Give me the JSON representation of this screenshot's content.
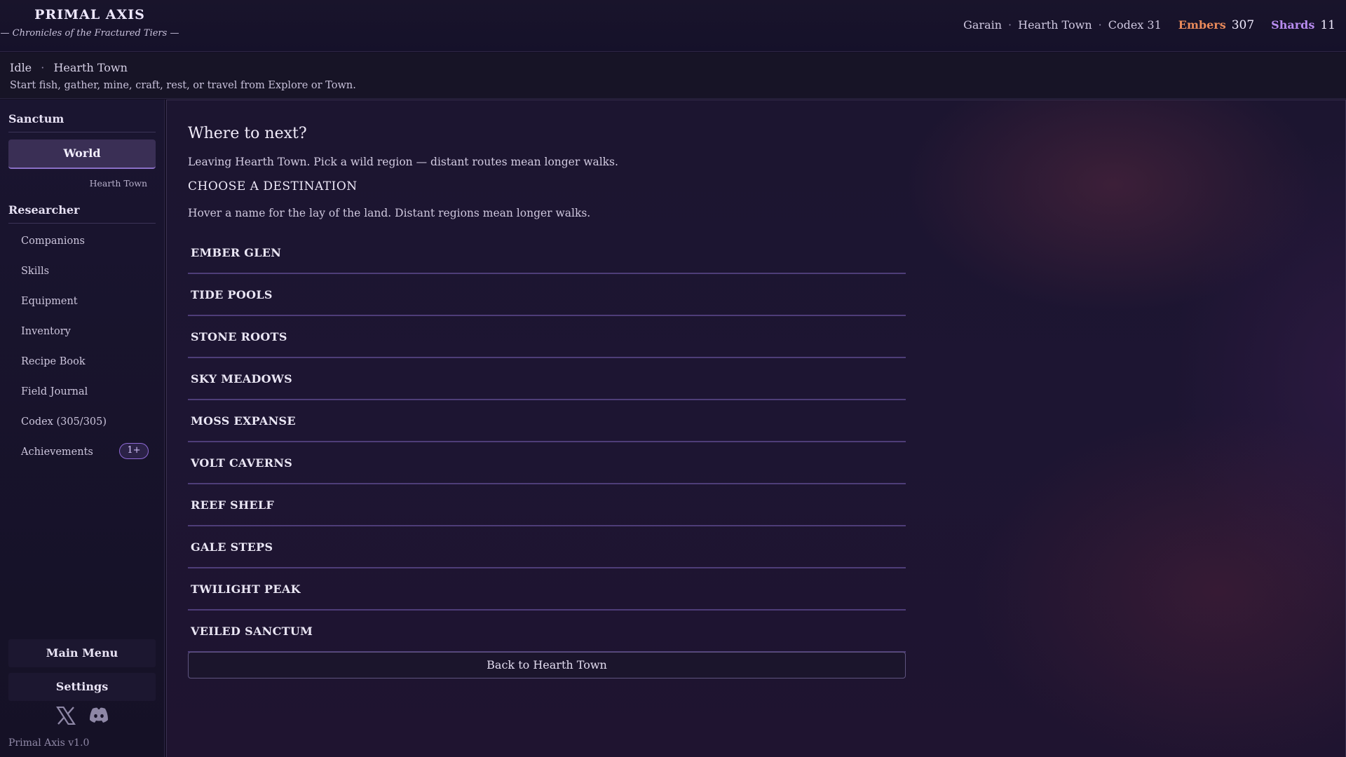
{
  "app": {
    "title": "PRIMAL AXIS",
    "subtitle": "— Chronicles of the Fractured Tiers —"
  },
  "hud": {
    "player": "Garain",
    "location": "Hearth Town",
    "codex": "Codex 31",
    "embers_label": "Embers",
    "embers_value": "307",
    "shards_label": "Shards",
    "shards_value": "11",
    "separator": "·"
  },
  "status": {
    "state": "Idle",
    "location": "Hearth Town",
    "hint": "Start fish, gather, mine, craft, rest, or travel from Explore or Town."
  },
  "sidebar": {
    "section_sanctum": "Sanctum",
    "world_button": "World",
    "current_location": "Hearth Town",
    "section_researcher": "Researcher",
    "items": [
      {
        "label": "Companions"
      },
      {
        "label": "Skills"
      },
      {
        "label": "Equipment"
      },
      {
        "label": "Inventory"
      },
      {
        "label": "Recipe Book"
      },
      {
        "label": "Field Journal"
      },
      {
        "label": "Codex (305/305)"
      },
      {
        "label": "Achievements"
      }
    ],
    "achievements_badge": "1+",
    "main_menu": "Main Menu",
    "settings": "Settings",
    "social_icons": [
      "x-icon",
      "discord-icon"
    ],
    "version": "Primal Axis  v1.0"
  },
  "main": {
    "title": "Where to next?",
    "description": "Leaving Hearth Town. Pick a wild region — distant routes mean longer walks.",
    "choose_heading": "CHOOSE A DESTINATION",
    "hover_hint": "Hover a name for the lay of the land. Distant regions mean longer walks.",
    "destinations": [
      "EMBER GLEN",
      "TIDE POOLS",
      "STONE ROOTS",
      "SKY MEADOWS",
      "MOSS EXPANSE",
      "VOLT CAVERNS",
      "REEF SHELF",
      "GALE STEPS",
      "TWILIGHT PEAK",
      "VEILED SANCTUM"
    ],
    "back_button": "Back to Hearth Town"
  },
  "colors": {
    "embers": "#e8895a",
    "shards": "#b88cf0",
    "accent": "#8a6fc6"
  }
}
